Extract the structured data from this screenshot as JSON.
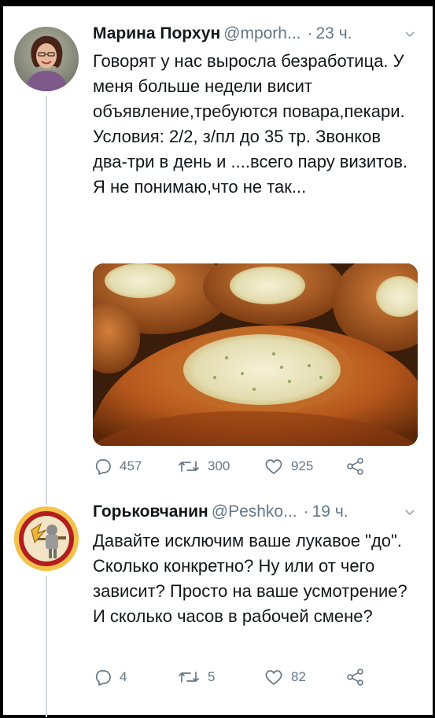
{
  "tweets": [
    {
      "author": "Марина Порхун",
      "handle": "@mporh...",
      "separator": "·",
      "time": "23 ч.",
      "text": "Говорят у нас выросла безработица. У меня больше недели висит объявление,требуются повара,пекари.  Условия: 2/2, з/пл до 35 тр. Звонков два-три в день и ....всего пару визитов. Я не понимаю,что не так...",
      "media": "photo-pastries",
      "replies": "457",
      "retweets": "300",
      "likes": "925"
    },
    {
      "author": "Горьковчанин",
      "handle": "@Peshko...",
      "separator": "·",
      "time": "19 ч.",
      "text": "Давайте исключим ваше лукавое \"до\". Сколько конкретно? Ну или от чего зависит? Просто на ваше усмотрение? И сколько часов в рабочей смене?",
      "replies": "4",
      "retweets": "5",
      "likes": "82"
    }
  ],
  "colors": {
    "text": "#14171a",
    "secondary": "#657786",
    "thread_line": "#d2d8dd",
    "avatar2_bg": "#f4c24a",
    "avatar2_ring": "#b21e1e"
  },
  "icons": [
    "reply-icon",
    "retweet-icon",
    "like-icon",
    "share-icon",
    "chevron-down-icon"
  ]
}
